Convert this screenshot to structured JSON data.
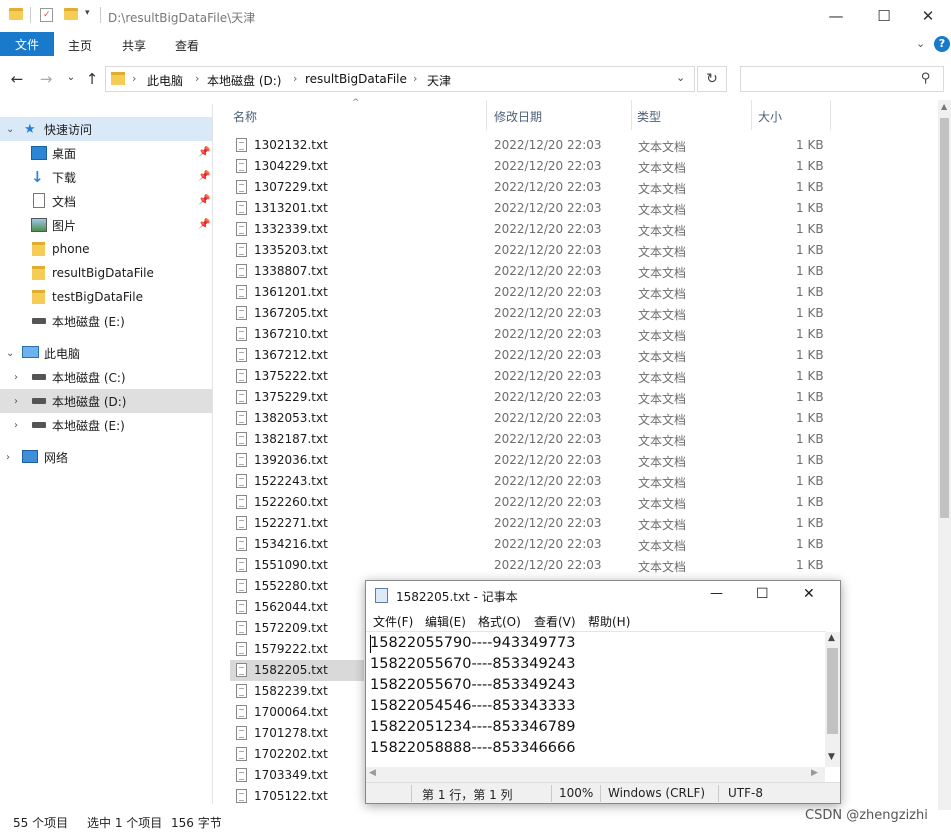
{
  "window": {
    "title": "D:\\resultBigDataFile\\天津",
    "controls": {
      "minimize": "—",
      "maximize": "☐",
      "close": "✕"
    }
  },
  "ribbon": {
    "tabs": [
      "文件",
      "主页",
      "共享",
      "查看"
    ]
  },
  "address": {
    "crumbs": [
      "此电脑",
      "本地磁盘 (D:)",
      "resultBigDataFile",
      "天津"
    ],
    "search_placeholder": ""
  },
  "sidebar": {
    "quick_access": "快速访问",
    "quick_items": [
      {
        "label": "桌面",
        "icon": "desktop-icon",
        "pinned": true
      },
      {
        "label": "下载",
        "icon": "download-icon",
        "pinned": true
      },
      {
        "label": "文档",
        "icon": "document-icon",
        "pinned": true
      },
      {
        "label": "图片",
        "icon": "picture-icon",
        "pinned": true
      },
      {
        "label": "phone",
        "icon": "folder-icon",
        "pinned": false
      },
      {
        "label": "resultBigDataFile",
        "icon": "folder-icon",
        "pinned": false
      },
      {
        "label": "testBigDataFile",
        "icon": "folder-icon",
        "pinned": false
      },
      {
        "label": "本地磁盘 (E:)",
        "icon": "drive-icon",
        "pinned": false
      }
    ],
    "this_pc": "此电脑",
    "drives": [
      "本地磁盘 (C:)",
      "本地磁盘 (D:)",
      "本地磁盘 (E:)"
    ],
    "network": "网络"
  },
  "columns": {
    "name": "名称",
    "date": "修改日期",
    "type": "类型",
    "size": "大小"
  },
  "files": [
    {
      "name": "1302132.txt",
      "date": "2022/12/20 22:03",
      "type": "文本文档",
      "size": "1 KB"
    },
    {
      "name": "1304229.txt",
      "date": "2022/12/20 22:03",
      "type": "文本文档",
      "size": "1 KB"
    },
    {
      "name": "1307229.txt",
      "date": "2022/12/20 22:03",
      "type": "文本文档",
      "size": "1 KB"
    },
    {
      "name": "1313201.txt",
      "date": "2022/12/20 22:03",
      "type": "文本文档",
      "size": "1 KB"
    },
    {
      "name": "1332339.txt",
      "date": "2022/12/20 22:03",
      "type": "文本文档",
      "size": "1 KB"
    },
    {
      "name": "1335203.txt",
      "date": "2022/12/20 22:03",
      "type": "文本文档",
      "size": "1 KB"
    },
    {
      "name": "1338807.txt",
      "date": "2022/12/20 22:03",
      "type": "文本文档",
      "size": "1 KB"
    },
    {
      "name": "1361201.txt",
      "date": "2022/12/20 22:03",
      "type": "文本文档",
      "size": "1 KB"
    },
    {
      "name": "1367205.txt",
      "date": "2022/12/20 22:03",
      "type": "文本文档",
      "size": "1 KB"
    },
    {
      "name": "1367210.txt",
      "date": "2022/12/20 22:03",
      "type": "文本文档",
      "size": "1 KB"
    },
    {
      "name": "1367212.txt",
      "date": "2022/12/20 22:03",
      "type": "文本文档",
      "size": "1 KB"
    },
    {
      "name": "1375222.txt",
      "date": "2022/12/20 22:03",
      "type": "文本文档",
      "size": "1 KB"
    },
    {
      "name": "1375229.txt",
      "date": "2022/12/20 22:03",
      "type": "文本文档",
      "size": "1 KB"
    },
    {
      "name": "1382053.txt",
      "date": "2022/12/20 22:03",
      "type": "文本文档",
      "size": "1 KB"
    },
    {
      "name": "1382187.txt",
      "date": "2022/12/20 22:03",
      "type": "文本文档",
      "size": "1 KB"
    },
    {
      "name": "1392036.txt",
      "date": "2022/12/20 22:03",
      "type": "文本文档",
      "size": "1 KB"
    },
    {
      "name": "1522243.txt",
      "date": "2022/12/20 22:03",
      "type": "文本文档",
      "size": "1 KB"
    },
    {
      "name": "1522260.txt",
      "date": "2022/12/20 22:03",
      "type": "文本文档",
      "size": "1 KB"
    },
    {
      "name": "1522271.txt",
      "date": "2022/12/20 22:03",
      "type": "文本文档",
      "size": "1 KB"
    },
    {
      "name": "1534216.txt",
      "date": "2022/12/20 22:03",
      "type": "文本文档",
      "size": "1 KB"
    },
    {
      "name": "1551090.txt",
      "date": "2022/12/20 22:03",
      "type": "文本文档",
      "size": "1 KB"
    },
    {
      "name": "1552280.txt"
    },
    {
      "name": "1562044.txt"
    },
    {
      "name": "1572209.txt"
    },
    {
      "name": "1579222.txt"
    },
    {
      "name": "1582205.txt",
      "selected": true
    },
    {
      "name": "1582239.txt"
    },
    {
      "name": "1700064.txt"
    },
    {
      "name": "1701278.txt"
    },
    {
      "name": "1702202.txt"
    },
    {
      "name": "1703349.txt"
    },
    {
      "name": "1705122.txt"
    }
  ],
  "status": {
    "count": "55 个项目",
    "selection": "选中 1 个项目",
    "size": "156 字节"
  },
  "notepad": {
    "title": "1582205.txt - 记事本",
    "menu": [
      "文件(F)",
      "编辑(E)",
      "格式(O)",
      "查看(V)",
      "帮助(H)"
    ],
    "lines": [
      "15822055790----943349773",
      "15822055670----853349243",
      "15822055670----853349243",
      "15822054546----853343333",
      "15822051234----853346789",
      "15822058888----853346666"
    ],
    "status": {
      "position": "第 1 行，第 1 列",
      "zoom": "100%",
      "eol": "Windows (CRLF)",
      "encoding": "UTF-8"
    }
  },
  "watermark": "CSDN @zhengzizhi"
}
